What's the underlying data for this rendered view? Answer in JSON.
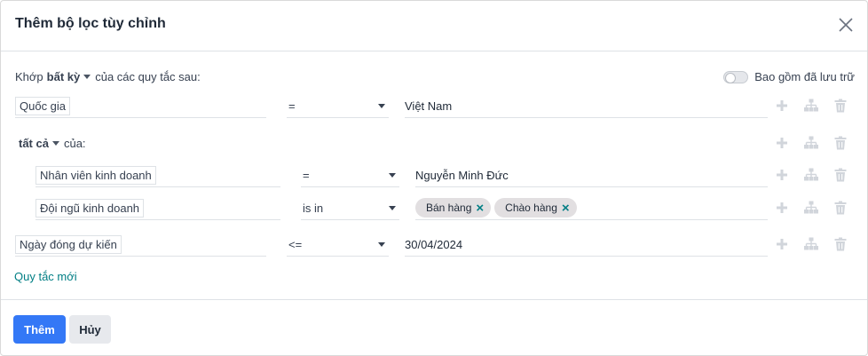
{
  "dialog": {
    "title": "Thêm bộ lọc tùy chỉnh"
  },
  "match": {
    "prefix": "Khớp",
    "mode": "bất kỳ",
    "suffix": "của các quy tắc sau:"
  },
  "archive": {
    "label": "Bao gồm đã lưu trữ",
    "enabled": false
  },
  "rules": [
    {
      "field": "Quốc gia",
      "operator": "=",
      "value": "Việt Nam"
    },
    {
      "field": "Ngày đóng dự kiến",
      "operator": "<=",
      "value": "30/04/2024"
    }
  ],
  "group": {
    "mode": "tất cả",
    "suffix": "của:",
    "rules": [
      {
        "field": "Nhân viên kinh doanh",
        "operator": "=",
        "value": "Nguyễn Minh Đức"
      },
      {
        "field": "Đội ngũ kinh doanh",
        "operator": "is in",
        "tags": [
          "Bán hàng",
          "Chào hàng"
        ]
      }
    ]
  },
  "links": {
    "new_rule": "Quy tắc mới"
  },
  "buttons": {
    "add": "Thêm",
    "cancel": "Hủy"
  },
  "icons": {
    "close": "close-icon",
    "add_rule": "plus-icon",
    "add_branch": "sitemap-icon",
    "delete": "trash-icon"
  },
  "colors": {
    "primary": "#3478f6",
    "link": "#017e84",
    "icon_disabled": "#d1d5db"
  }
}
